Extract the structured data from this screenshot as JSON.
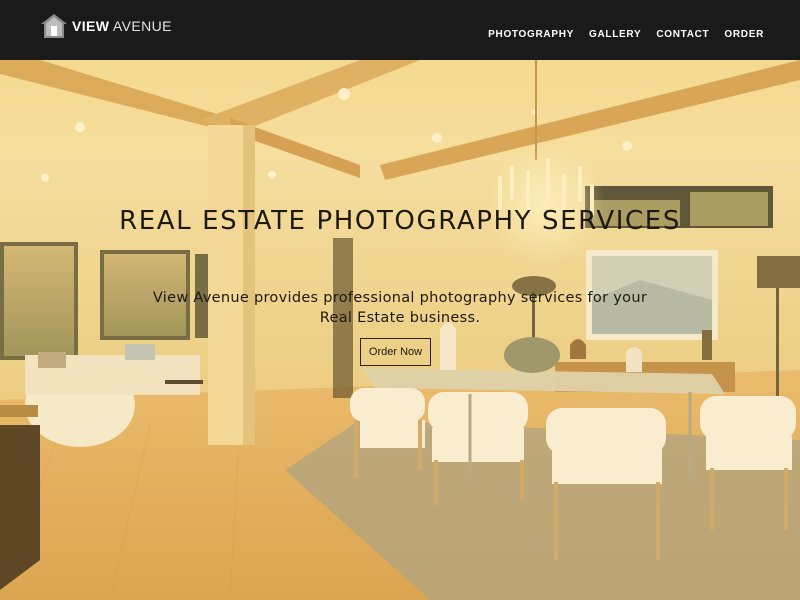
{
  "brand": {
    "name_strong": "VIEW",
    "name_light": "AVENUE",
    "icon": "house-icon"
  },
  "nav": {
    "items": [
      {
        "label": "PHOTOGRAPHY"
      },
      {
        "label": "GALLERY"
      },
      {
        "label": "CONTACT"
      },
      {
        "label": "ORDER"
      }
    ]
  },
  "hero": {
    "title": "REAL ESTATE PHOTOGRAPHY SERVICES",
    "subtitle": "View Avenue provides professional photography services for your Real Estate business.",
    "cta_label": "Order Now",
    "background_image": "real-estate-dining-room-interior"
  },
  "colors": {
    "navbar_bg": "#1a1a1a",
    "nav_text": "#ffffff",
    "hero_text": "#1d1a14",
    "warm_overlay": "#ffcd5f"
  }
}
